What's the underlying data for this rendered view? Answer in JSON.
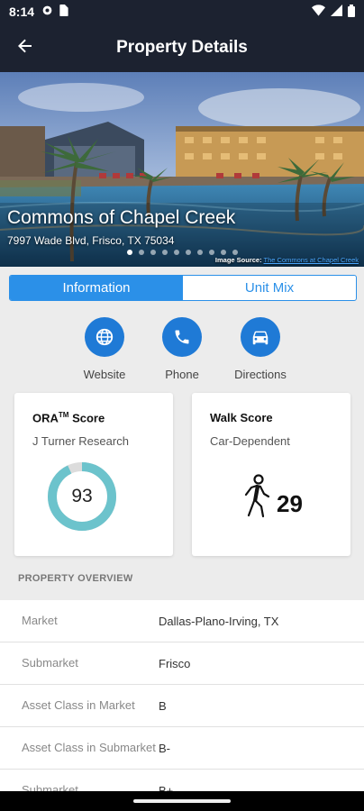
{
  "status": {
    "time": "8:14",
    "icons_left": [
      "gear-icon",
      "sim-card-icon"
    ],
    "icons_right": [
      "wifi-icon",
      "signal-icon",
      "battery-icon"
    ]
  },
  "header": {
    "title": "Property Details",
    "back_icon": "arrow-left-icon"
  },
  "hero": {
    "name": "Commons of Chapel Creek",
    "address": "7997 Wade Blvd, Frisco, TX 75034",
    "image_source_label": "Image Source:",
    "image_source_link": "The Commons at Chapel Creek",
    "carousel_count": 10,
    "carousel_active": 0
  },
  "tabs": [
    {
      "label": "Information",
      "active": true
    },
    {
      "label": "Unit Mix",
      "active": false
    }
  ],
  "actions": [
    {
      "label": "Website",
      "icon": "globe-icon"
    },
    {
      "label": "Phone",
      "icon": "phone-icon"
    },
    {
      "label": "Directions",
      "icon": "car-icon"
    }
  ],
  "ora_card": {
    "title": "ORA",
    "title_sup": "TM",
    "title_suffix": " Score",
    "subtitle": "J Turner Research",
    "score": "93",
    "score_fraction": 0.93
  },
  "walk_card": {
    "title": "Walk Score",
    "subtitle": "Car-Dependent",
    "score": "29",
    "icon": "pedestrian-icon"
  },
  "overview": {
    "section_title": "PROPERTY OVERVIEW",
    "rows": [
      {
        "key": "Market",
        "value": "Dallas-Plano-Irving, TX"
      },
      {
        "key": "Submarket",
        "value": "Frisco"
      },
      {
        "key": "Asset Class in Market",
        "value": "B"
      },
      {
        "key": "Asset Class in Submarket",
        "value": "B-"
      },
      {
        "key": "Submarket",
        "value": "B+"
      }
    ]
  },
  "colors": {
    "header_bg": "#1c2230",
    "accent_blue": "#2b90e8",
    "action_blue": "#1f7ad6",
    "donut_teal": "#6cc3cc",
    "donut_track": "#dcdcdc"
  }
}
